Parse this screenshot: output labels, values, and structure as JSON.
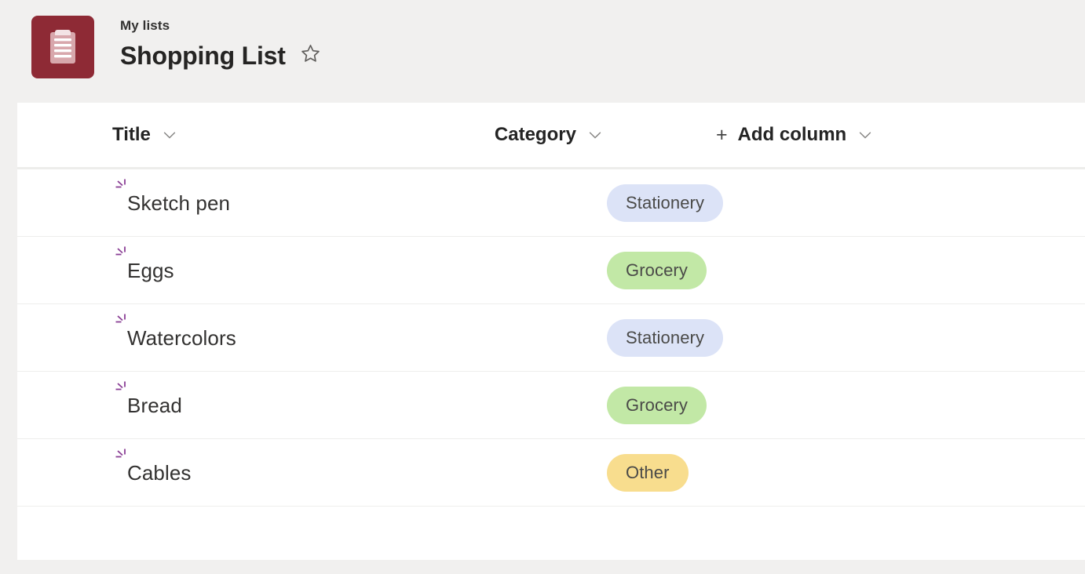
{
  "header": {
    "app_icon": "clipboard-icon",
    "icon_tile_color": "#8e2a35",
    "breadcrumb": "My lists",
    "title": "Shopping List",
    "favorite_icon": "star-outline-icon"
  },
  "table": {
    "columns": [
      {
        "label": "Title",
        "sort_icon": "chevron-down-icon"
      },
      {
        "label": "Category",
        "sort_icon": "chevron-down-icon"
      },
      {
        "label": "Add column",
        "add_icon": "plus-icon",
        "sort_icon": "chevron-down-icon"
      }
    ],
    "rows": [
      {
        "new_icon": "sparkle-icon",
        "title": "Sketch pen",
        "category": "Stationery",
        "category_color": "#dce3f7"
      },
      {
        "new_icon": "sparkle-icon",
        "title": "Eggs",
        "category": "Grocery",
        "category_color": "#c2e8a6"
      },
      {
        "new_icon": "sparkle-icon",
        "title": "Watercolors",
        "category": "Stationery",
        "category_color": "#dce3f7"
      },
      {
        "new_icon": "sparkle-icon",
        "title": "Bread",
        "category": "Grocery",
        "category_color": "#c2e8a6"
      },
      {
        "new_icon": "sparkle-icon",
        "title": "Cables",
        "category": "Other",
        "category_color": "#f8dd8e"
      }
    ]
  },
  "colors": {
    "page_background": "#f1f0ef",
    "card_background": "#ffffff",
    "accent_red": "#8e2a35",
    "sparkle_purple": "#8a3f95",
    "text_primary": "#252423",
    "row_divider": "#eeeeec"
  }
}
